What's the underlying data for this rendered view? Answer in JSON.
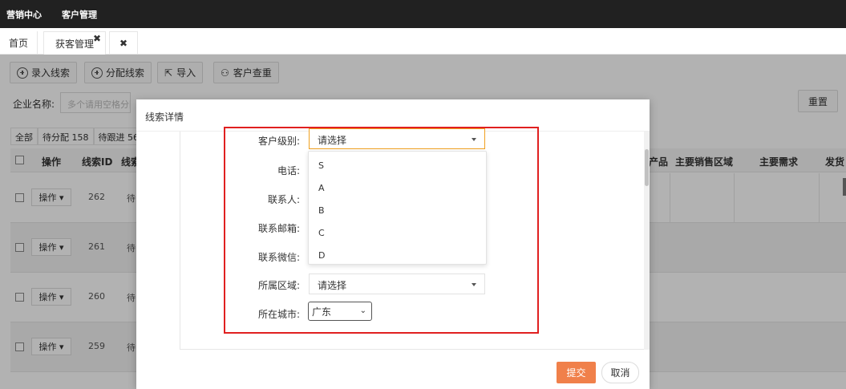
{
  "topbar": {
    "items": [
      "营销中心",
      "客户管理"
    ]
  },
  "tabs": {
    "home": "首页",
    "active": "获客管理",
    "active_close": "✖",
    "close_all": "✖"
  },
  "toolbar": {
    "add_lead": "录入线索",
    "assign_lead": "分配线索",
    "import": "导入",
    "dedupe": "客户查重"
  },
  "filters": {
    "company_label": "企业名称:",
    "company_placeholder": "多个请用空格分隔",
    "reset": "重置"
  },
  "subtabs": [
    "全部",
    "待分配 158",
    "待跟进 56"
  ],
  "table": {
    "headers": {
      "ops": "操作",
      "lead_id": "线索ID",
      "lead_status": "线索",
      "product": "产品",
      "sales_region": "主要销售区域",
      "main_need": "主要需求",
      "other": "发货"
    },
    "op_label": "操作 ▾",
    "rows": [
      {
        "id": "262",
        "status": "待"
      },
      {
        "id": "261",
        "status": "待"
      },
      {
        "id": "260",
        "status": "待"
      },
      {
        "id": "259",
        "status": "待"
      }
    ]
  },
  "modal": {
    "title": "线索详情",
    "fields": {
      "customer_level": {
        "label": "客户级别:",
        "value": "请选择"
      },
      "phone": {
        "label": "电话:"
      },
      "contact": {
        "label": "联系人:"
      },
      "email": {
        "label": "联系邮箱:"
      },
      "wechat": {
        "label": "联系微信:"
      },
      "region": {
        "label": "所属区域:",
        "value": "请选择"
      },
      "city": {
        "label": "所在城市:",
        "value": "广东"
      }
    },
    "level_options": [
      "S",
      "A",
      "B",
      "C",
      "D"
    ],
    "submit": "提交",
    "cancel": "取消"
  },
  "colors": {
    "accent": "#f0804a",
    "highlight": "#e02020",
    "focus": "#f0a020",
    "topbar": "#212121"
  }
}
